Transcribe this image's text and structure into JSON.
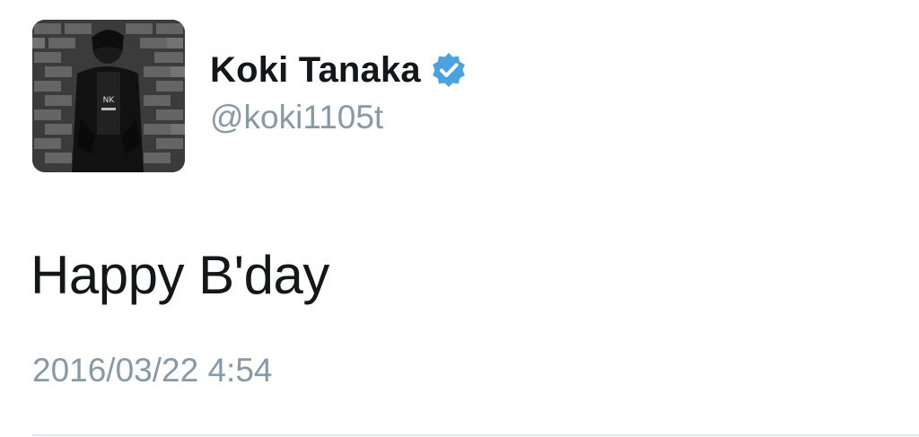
{
  "tweet": {
    "author": {
      "display_name": "Koki Tanaka",
      "handle": "@koki1105t",
      "verified": true,
      "avatar_icon": "profile-photo"
    },
    "text": "Happy B'day",
    "timestamp": "2016/03/22 4:54"
  },
  "colors": {
    "verified_badge": "#4aa3df",
    "secondary_text": "#8899a6",
    "primary_text": "#14171a",
    "divider": "#e1e8ed"
  }
}
